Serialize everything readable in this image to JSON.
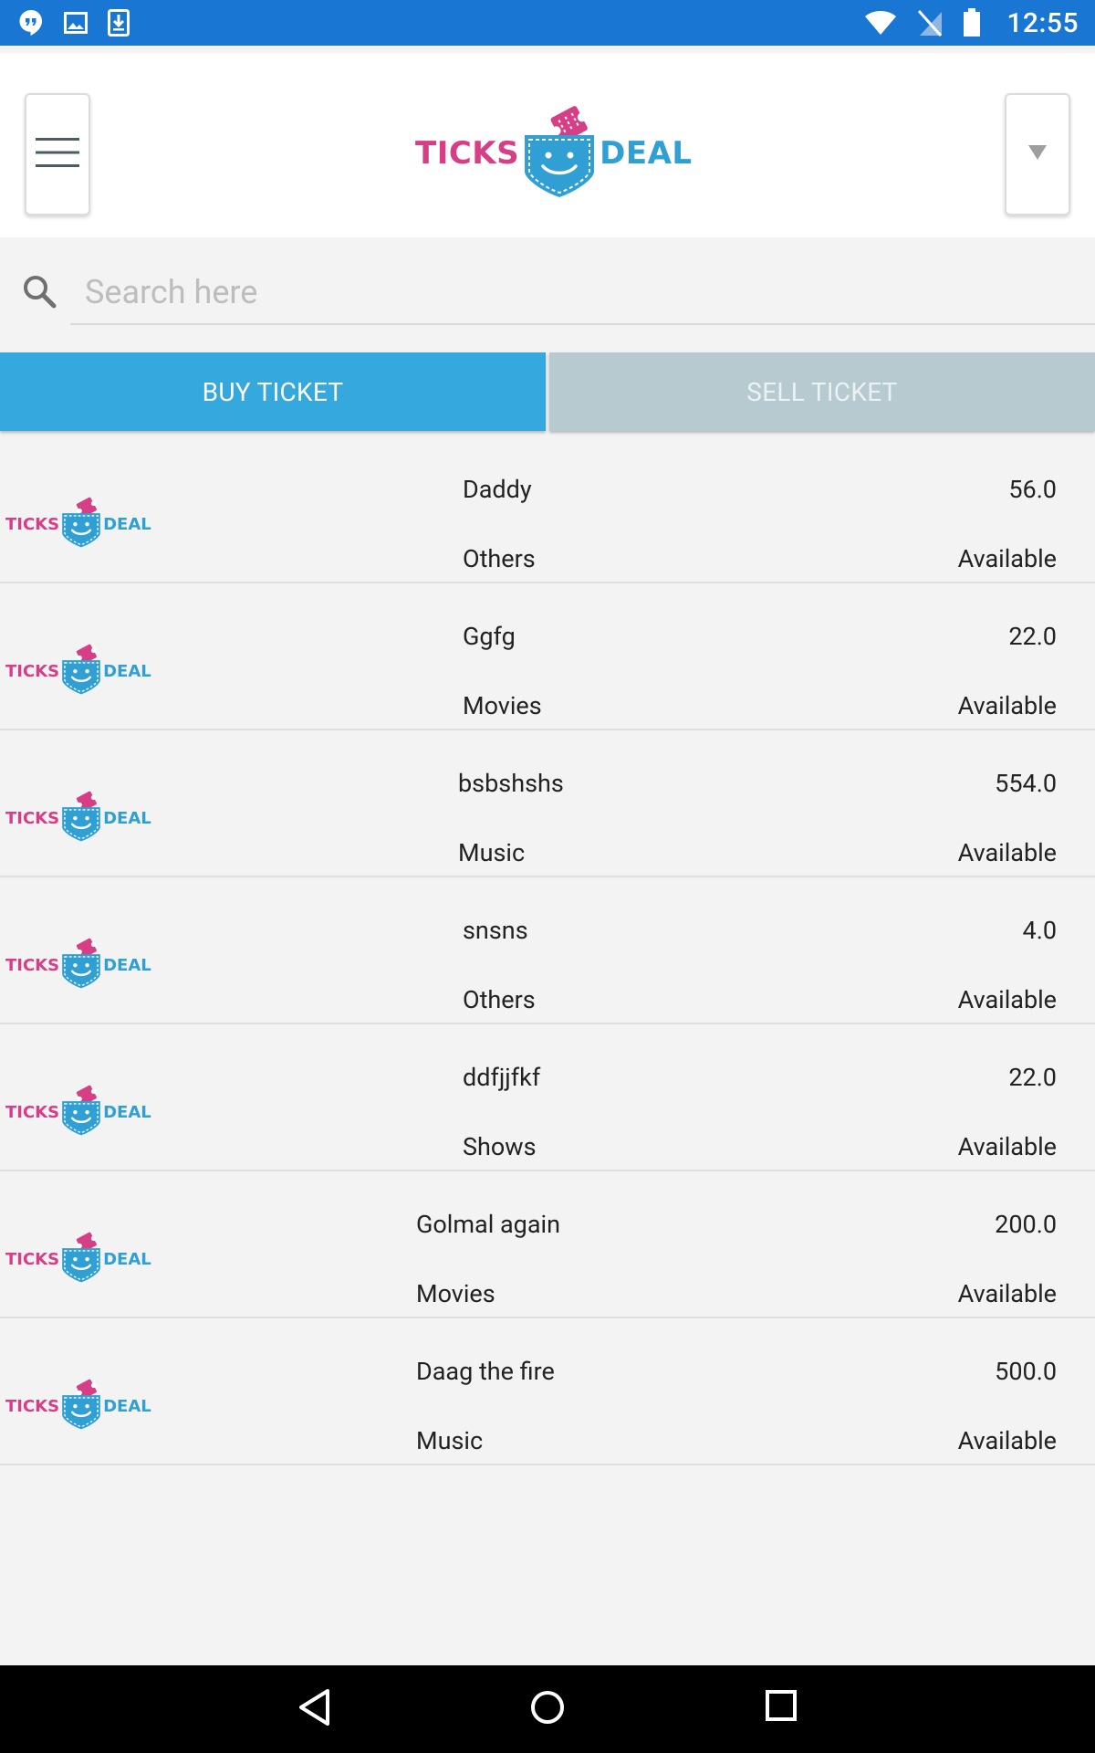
{
  "status_bar": {
    "time": "12:55",
    "icons": [
      "hangouts-icon",
      "image-icon",
      "download-icon",
      "wifi-icon",
      "no-sim-icon",
      "battery-icon"
    ]
  },
  "header": {
    "logo": {
      "left": "TICKS",
      "right": "DEAL"
    },
    "menu_icon": "hamburger-menu-icon",
    "dropdown_icon": "triangle-down-icon"
  },
  "search": {
    "placeholder": "Search here",
    "value": ""
  },
  "tabs": {
    "buy_label": "BUY TICKET",
    "sell_label": "SELL TICKET",
    "active": "buy"
  },
  "tickets": [
    {
      "name": "Daddy",
      "category": "Others",
      "price": "56.0",
      "status": "Available"
    },
    {
      "name": "Ggfg",
      "category": "Movies",
      "price": "22.0",
      "status": "Available"
    },
    {
      "name": "bsbshshs",
      "category": "Music",
      "price": "554.0",
      "status": "Available"
    },
    {
      "name": "snsns",
      "category": "Others",
      "price": "4.0",
      "status": "Available"
    },
    {
      "name": "ddfjjfkf",
      "category": "Shows",
      "price": "22.0",
      "status": "Available"
    },
    {
      "name": "Golmal again",
      "category": "Movies",
      "price": "200.0",
      "status": "Available"
    },
    {
      "name": "Daag the fire",
      "category": "Music",
      "price": "500.0",
      "status": "Available"
    }
  ],
  "colors": {
    "status_bar": "#1976d2",
    "buy_tab": "#35a9dd",
    "sell_tab": "#b6cacf",
    "logo_pink": "#d63e86",
    "logo_blue": "#2f9fd4"
  }
}
